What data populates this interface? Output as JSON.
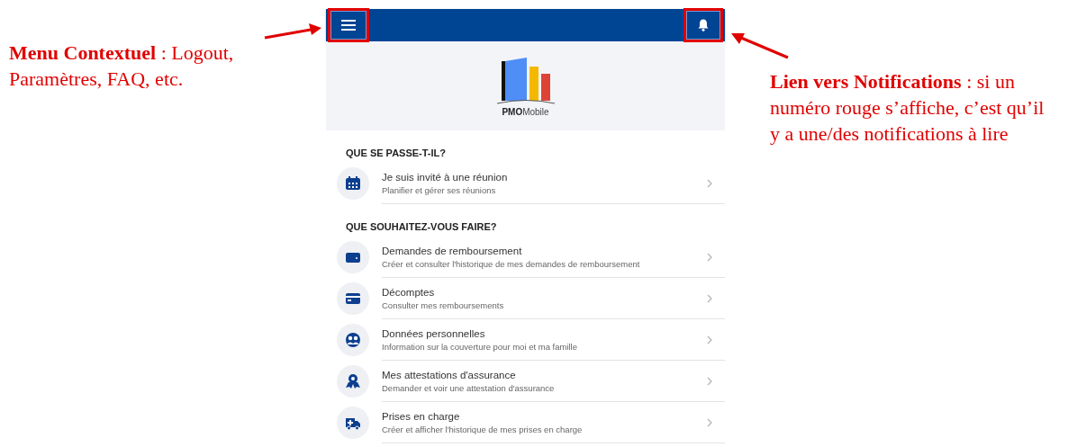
{
  "left_note": {
    "text": "**Menu Contextuel** : Logout, Paramètres, FAQ, etc."
  },
  "right_note": {
    "text": "**Lien vers Notifications** : si un numéro rouge s’affiche, c’est qu’il y a une/des notifications à lire"
  },
  "app_bar": {
    "menu_button": {
      "highlighted": true
    },
    "notifications_button": {
      "highlighted": true
    }
  },
  "logo": {
    "wordmark": "**PMO**Mobile"
  },
  "sections": [
    {
      "heading": "QUE SE PASSE-T-IL?",
      "items": [
        {
          "kind": "calendar",
          "title": "Je suis invité à une réunion",
          "subtitle": "Planifier et gérer ses réunions"
        }
      ]
    },
    {
      "heading": "QUE SOUHAITEZ-VOUS FAIRE?",
      "items": [
        {
          "kind": "wallet",
          "title": "Demandes de remboursement",
          "subtitle": "Créer et consulter l'historique de mes demandes de remboursement"
        },
        {
          "kind": "card",
          "title": "Décomptes",
          "subtitle": "Consulter mes remboursements"
        },
        {
          "kind": "people",
          "title": "Données personnelles",
          "subtitle": "Information sur la couverture pour moi et ma famille"
        },
        {
          "kind": "award",
          "title": "Mes attestations d'assurance",
          "subtitle": "Demander et voir une attestation d'assurance"
        },
        {
          "kind": "ambulance",
          "title": "Prises en charge",
          "subtitle": "Créer et afficher l'historique de mes prises en charge"
        }
      ]
    }
  ]
}
